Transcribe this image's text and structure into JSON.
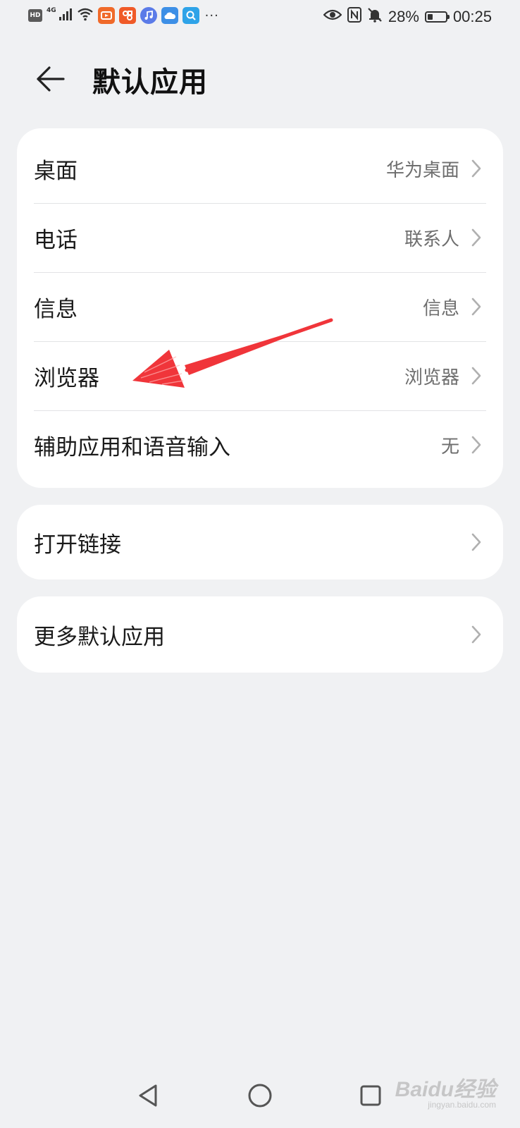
{
  "status_bar": {
    "hd_label": "HD",
    "network_label": "4G",
    "battery_percent": "28%",
    "battery_level": 0.28,
    "time": "00:25",
    "app_icons": [
      {
        "name": "video-app-icon",
        "color": "#f06a2a"
      },
      {
        "name": "shop-app-icon",
        "color": "#f05a28"
      },
      {
        "name": "music-app-icon",
        "color": "#5b7be8"
      },
      {
        "name": "cloud-app-icon",
        "color": "#3d8fe6"
      },
      {
        "name": "search-app-icon",
        "color": "#2ea3e8"
      }
    ],
    "more_label": "···"
  },
  "header": {
    "title": "默认应用"
  },
  "sections": {
    "main": [
      {
        "label": "桌面",
        "value": "华为桌面"
      },
      {
        "label": "电话",
        "value": "联系人"
      },
      {
        "label": "信息",
        "value": "信息"
      },
      {
        "label": "浏览器",
        "value": "浏览器"
      },
      {
        "label": "辅助应用和语音输入",
        "value": "无"
      }
    ],
    "open_links": {
      "label": "打开链接"
    },
    "more_defaults": {
      "label": "更多默认应用"
    }
  },
  "annotation": {
    "color": "#f0353a"
  },
  "watermark": {
    "main": "Baidu经验",
    "sub": "jingyan.baidu.com"
  }
}
